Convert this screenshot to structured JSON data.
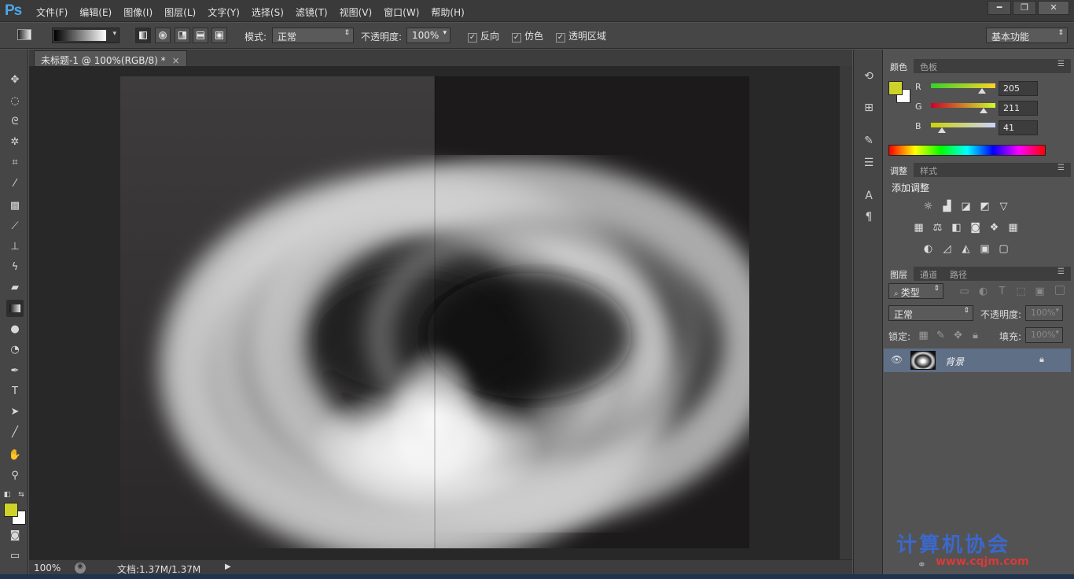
{
  "menubar": {
    "logo": "Ps",
    "items": [
      "文件(F)",
      "编辑(E)",
      "图像(I)",
      "图层(L)",
      "文字(Y)",
      "选择(S)",
      "滤镜(T)",
      "视图(V)",
      "窗口(W)",
      "帮助(H)"
    ],
    "window_controls": {
      "minimize": "━",
      "restore": "❐",
      "close": "✕"
    }
  },
  "options": {
    "mode_label": "模式:",
    "mode_value": "正常",
    "opacity_label": "不透明度:",
    "opacity_value": "100%",
    "reverse": "反向",
    "dither": "仿色",
    "transparency": "透明区域",
    "workspace": "基本功能"
  },
  "document": {
    "tab_title": "未标题-1 @ 100%(RGB/8) *",
    "tab_close": "×",
    "zoom": "100%",
    "doc_info": "文档:1.37M/1.37M"
  },
  "colors": {
    "foreground": "#cdd329",
    "background": "#ffffff"
  },
  "color_panel": {
    "tab_active": "颜色",
    "tab_other": "色板",
    "r_label": "R",
    "r_value": "205",
    "g_label": "G",
    "g_value": "211",
    "b_label": "B",
    "b_value": "41"
  },
  "adjust_panel": {
    "tab_active": "调整",
    "tab_other": "样式",
    "heading": "添加调整"
  },
  "layers_panel": {
    "tab_active": "图层",
    "tab_channels": "通道",
    "tab_paths": "路径",
    "filter_kind": "类型",
    "blend_mode": "正常",
    "opacity_label": "不透明度:",
    "opacity_value": "100%",
    "lock_label": "锁定:",
    "fill_label": "填充:",
    "fill_value": "100%",
    "layer_name": "背景"
  },
  "watermark": {
    "text": "计算机协会",
    "url": "www.cqjm.com"
  }
}
